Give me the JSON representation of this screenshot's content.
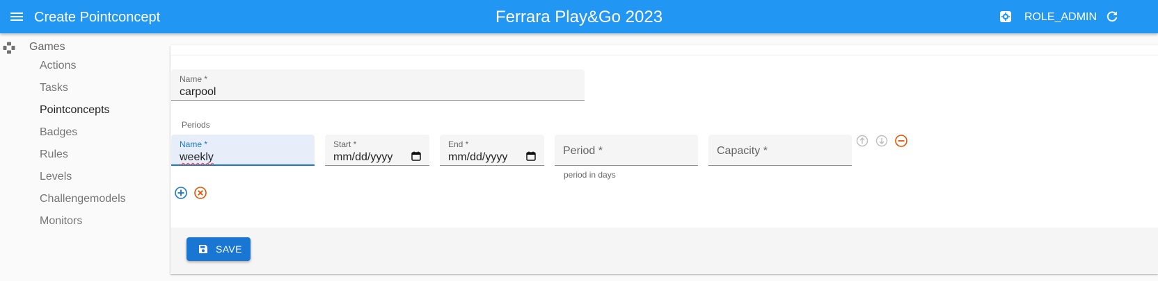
{
  "appbar": {
    "title": "Create Pointconcept",
    "app_name": "Ferrara Play&Go 2023",
    "role": "ROLE_ADMIN",
    "color": "#2196f3",
    "icons": [
      "menu-icon",
      "settings-icon",
      "refresh-icon"
    ]
  },
  "sidebar": {
    "games_label": "Games",
    "items": [
      {
        "label": "Actions"
      },
      {
        "label": "Tasks"
      },
      {
        "label": "Pointconcepts",
        "active": true
      },
      {
        "label": "Badges"
      },
      {
        "label": "Rules"
      },
      {
        "label": "Levels"
      },
      {
        "label": "Challengemodels"
      },
      {
        "label": "Monitors"
      }
    ]
  },
  "form": {
    "name": {
      "label": "Name *",
      "value": "carpool"
    },
    "periods_label": "Periods",
    "period": {
      "name": {
        "label": "Name *",
        "value": "weekly"
      },
      "start": {
        "label": "Start *",
        "value": "mm/dd/yyyy"
      },
      "end": {
        "label": "End *",
        "value": "mm/dd/yyyy"
      },
      "period": {
        "placeholder": "Period *",
        "helper": "period in days"
      },
      "capacity": {
        "placeholder": "Capacity *"
      }
    },
    "row_actions": [
      "move-up-icon",
      "move-down-icon",
      "remove-icon"
    ],
    "list_actions": [
      "add-icon",
      "clear-icon"
    ]
  },
  "toolbar": {
    "save_label": "SAVE",
    "save_color": "#1976d2"
  }
}
